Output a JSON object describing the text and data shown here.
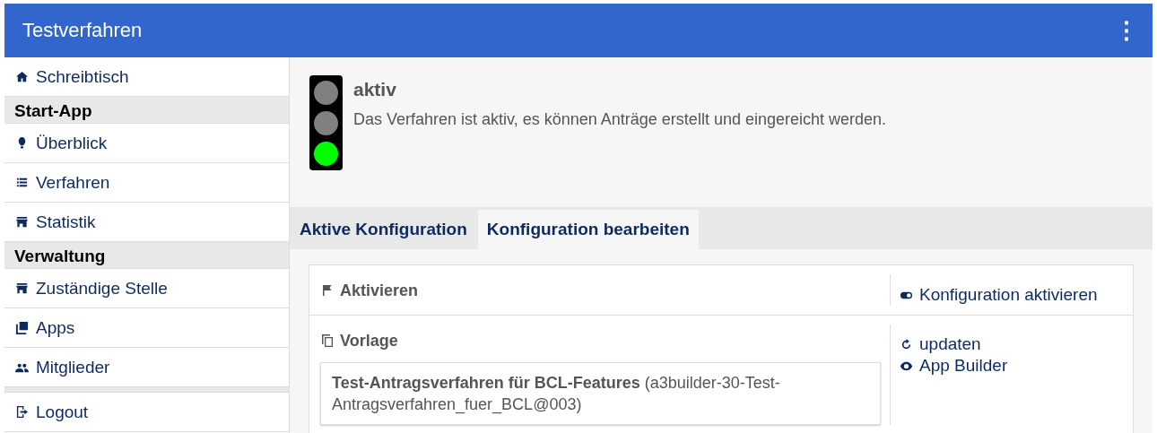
{
  "app_bar": {
    "title": "Testverfahren",
    "menu": "⋮"
  },
  "sidebar": {
    "items": [
      {
        "kind": "item",
        "label": "Schreibtisch"
      },
      {
        "kind": "heading",
        "label": "Start-App"
      },
      {
        "kind": "item",
        "label": "Überblick"
      },
      {
        "kind": "item",
        "label": "Verfahren"
      },
      {
        "kind": "item",
        "label": "Statistik"
      },
      {
        "kind": "heading",
        "label": "Verwaltung"
      },
      {
        "kind": "item",
        "label": "Zuständige Stelle"
      },
      {
        "kind": "item",
        "label": "Apps"
      },
      {
        "kind": "item",
        "label": "Mitglieder"
      },
      {
        "kind": "spacer"
      },
      {
        "kind": "item",
        "label": "Logout"
      }
    ]
  },
  "status": {
    "title": "aktiv",
    "description": "Das Verfahren ist aktiv, es können Anträge erstellt und eingereicht werden.",
    "lights": [
      {
        "color": "#808080"
      },
      {
        "color": "#808080"
      },
      {
        "color": "#00ff00"
      }
    ]
  },
  "tabs": [
    {
      "label": "Aktive Konfiguration",
      "selected": false
    },
    {
      "label": "Konfiguration bearbeiten",
      "selected": true
    }
  ],
  "sections": [
    {
      "title": "Aktivieren",
      "actions": [
        "Konfiguration aktivieren"
      ]
    },
    {
      "title": "Vorlage",
      "template": {
        "name": "Test-Antragsverfahren für BCL-Features",
        "id": "(a3builder-30-Test-Antragsverfahren_fuer_BCL@003)"
      },
      "actions": [
        "updaten",
        "App Builder"
      ]
    }
  ]
}
